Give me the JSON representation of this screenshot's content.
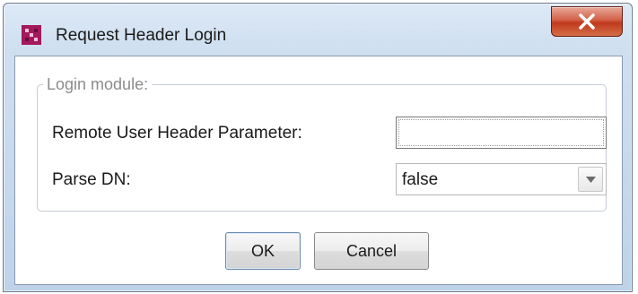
{
  "window": {
    "title": "Request Header Login",
    "app_icon": "app-logo-icon",
    "close_icon": "close-icon"
  },
  "form": {
    "group_label": "Login module:",
    "remote_user_label": "Remote User Header Parameter:",
    "remote_user_value": "",
    "parse_dn_label": "Parse DN:",
    "parse_dn_value": "false",
    "parse_dn_arrow_icon": "chevron-down-icon"
  },
  "buttons": {
    "ok": "OK",
    "cancel": "Cancel"
  },
  "colors": {
    "close_button": "#c8452a",
    "app_icon": "#a3195b",
    "legend_text": "#8c8c8c"
  }
}
